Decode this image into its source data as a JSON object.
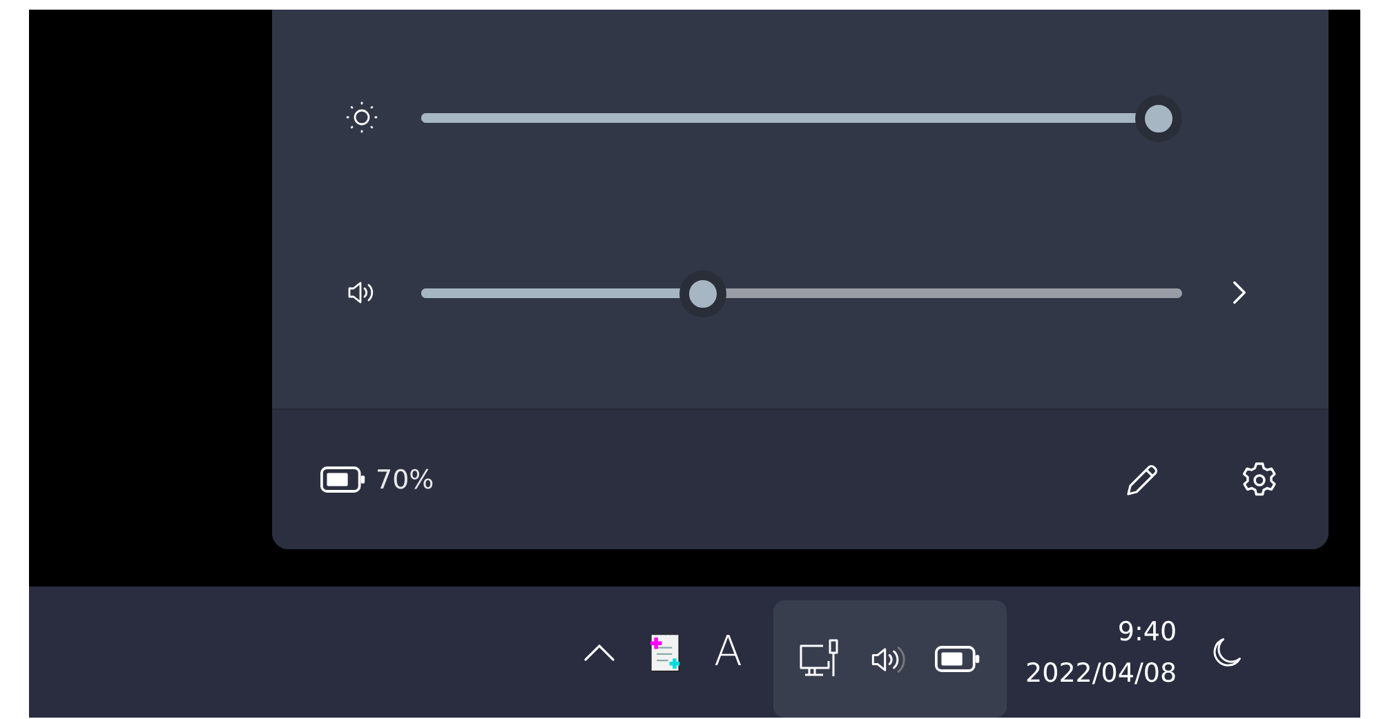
{
  "quick_settings": {
    "sliders": [
      {
        "kind": "brightness",
        "level": 0.97,
        "expandable": false
      },
      {
        "kind": "volume",
        "level": 0.37,
        "expandable": true
      }
    ],
    "footer": {
      "battery": "70%"
    }
  },
  "taskbar": {
    "input_indicator": "A",
    "clock": {
      "time": "9:40",
      "date": "2022/04/08"
    }
  }
}
